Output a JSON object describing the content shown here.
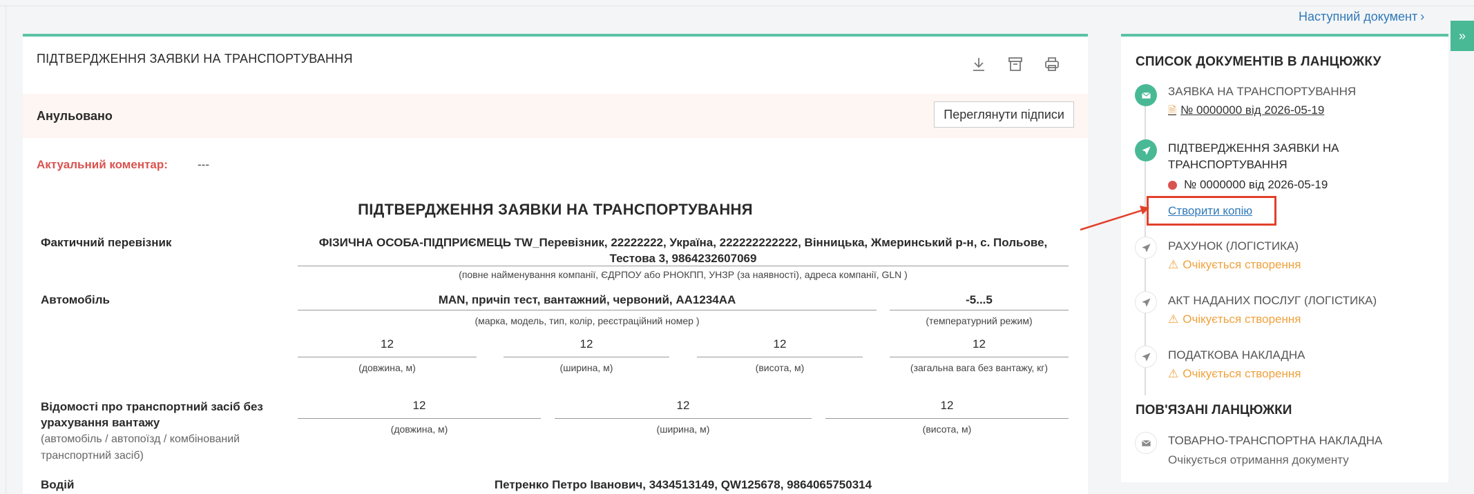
{
  "nav": {
    "next_document": "Наступний документ",
    "sidebar_toggle": "»"
  },
  "document": {
    "card_title": "ПІДТВЕРДЖЕННЯ ЗАЯВКИ НА ТРАНСПОРТУВАННЯ",
    "toolbar": {
      "download_icon": "download-icon",
      "archive_icon": "archive-icon",
      "print_icon": "print-icon"
    },
    "status": "Анульовано",
    "view_signatures_label": "Переглянути підписи",
    "comment_label": "Актуальний коментар:",
    "comment_value": "---",
    "heading": "ПІДТВЕРДЖЕННЯ ЗАЯВКИ НА ТРАНСПОРТУВАННЯ",
    "carrier": {
      "label": "Фактичний перевізник",
      "value": "ФІЗИЧНА ОСОБА-ПІДПРИЄМЕЦЬ TW_Перевізник, 22222222, Україна, 222222222222, Вінницька, Жмеринський р-н, с. Польове, Тестова 3, 9864232607069",
      "hint": "(повне найменування компанії, ЄДРПОУ або РНОКПП, УНЗР (за наявності), адреса компанії, GLN )"
    },
    "vehicle": {
      "label": "Автомобіль",
      "value": "MAN, причіп тест, вантажний, червоний, AA1234AA",
      "hint": "(марка, модель, тип, колір, реєстраційний номер )",
      "temp_value": "-5...5",
      "temp_hint": "(температурний режим)",
      "length": "12",
      "length_hint": "(довжина, м)",
      "width": "12",
      "width_hint": "(ширина, м)",
      "height": "12",
      "height_hint": "(висота, м)",
      "weight": "12",
      "weight_hint": "(загальна вага без вантажу, кг)"
    },
    "unloaded": {
      "label": "Відомості про транспортний засіб без урахування вантажу",
      "sub": "(автомобіль / автопоїзд / комбінований транспортний засіб)",
      "length": "12",
      "length_hint": "(довжина, м)",
      "width": "12",
      "width_hint": "(ширина, м)",
      "height": "12",
      "height_hint": "(висота, м)"
    },
    "driver": {
      "label": "Водій",
      "value": "Петренко Петро Іванович, 3434513149, QW125678, 9864065750314"
    }
  },
  "chain": {
    "title": "СПИСОК ДОКУМЕНТІВ В ЛАНЦЮЖКУ",
    "items": [
      {
        "title": "ЗАЯВКА НА ТРАНСПОРТУВАННЯ",
        "link": "№ 0000000 від 2026-05-19",
        "icon": "envelope-icon"
      },
      {
        "title": "ПІДТВЕРДЖЕННЯ ЗАЯВКИ НА ТРАНСПОРТУВАННЯ",
        "number": "№ 0000000 від 2026-05-19",
        "copy_link": "Створити копію",
        "icon": "send-icon"
      },
      {
        "title": "РАХУНОК (ЛОГІСТИКА)",
        "status": "Очікується створення",
        "icon": "send-icon"
      },
      {
        "title": "АКТ НАДАНИХ ПОСЛУГ (ЛОГІСТИКА)",
        "status": "Очікується створення",
        "icon": "send-icon"
      },
      {
        "title": "ПОДАТКОВА НАКЛАДНА",
        "status": "Очікується створення",
        "icon": "send-icon"
      }
    ],
    "related_title": "ПОВ'ЯЗАНІ ЛАНЦЮЖКИ",
    "related": [
      {
        "title": "ТОВАРНО-ТРАНСПОРТНА НАКЛАДНА",
        "status": "Очікується отримання документу",
        "icon": "envelope-icon"
      }
    ]
  },
  "colors": {
    "accent": "#5ac2a5",
    "warning": "#f0a13c",
    "danger": "#d9534f",
    "link": "#2f79b8",
    "annotation": "#e2402a"
  }
}
